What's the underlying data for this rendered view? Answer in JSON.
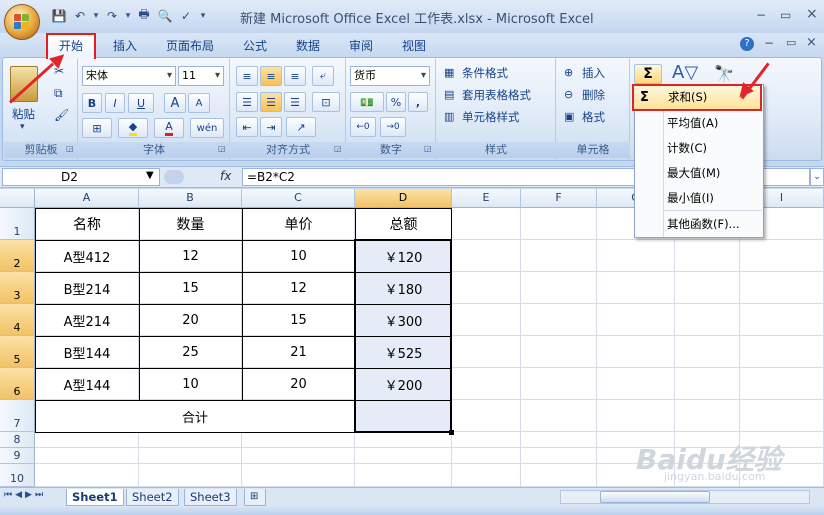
{
  "window": {
    "title": "新建 Microsoft Office Excel 工作表.xlsx - Microsoft Excel",
    "minimize": "−",
    "restore": "▭",
    "close": "×"
  },
  "tabs": [
    "开始",
    "插入",
    "页面布局",
    "公式",
    "数据",
    "审阅",
    "视图"
  ],
  "ribbon": {
    "clipboard": {
      "label": "剪贴板",
      "paste": "粘贴"
    },
    "font": {
      "label": "字体",
      "name": "宋体",
      "size": "11",
      "bold": "B",
      "italic": "I",
      "underline": "U",
      "grow": "A",
      "shrink": "A",
      "color_letter": "A",
      "phonetic": "wén"
    },
    "alignment": {
      "label": "对齐方式"
    },
    "number": {
      "label": "数字",
      "format": "货币",
      "percent": "%",
      "comma": ","
    },
    "styles": {
      "label": "样式",
      "conditional": "条件格式",
      "table": "套用表格格式",
      "cell": "单元格样式"
    },
    "cells": {
      "label": "单元格",
      "insert": "插入",
      "delete": "删除",
      "format": "格式"
    },
    "editing": {
      "sigma": "Σ"
    }
  },
  "formula_bar": {
    "name": "D2",
    "fx": "fx",
    "formula": "=B2*C2"
  },
  "columns": [
    "A",
    "B",
    "C",
    "D",
    "E",
    "F",
    "G",
    "H",
    "I"
  ],
  "rows": [
    "1",
    "2",
    "3",
    "4",
    "5",
    "6",
    "7",
    "8",
    "9",
    "10"
  ],
  "table": {
    "headers": [
      "名称",
      "数量",
      "单价",
      "总额"
    ],
    "rows": [
      [
        "A型412",
        "12",
        "10",
        "￥120"
      ],
      [
        "B型214",
        "15",
        "12",
        "￥180"
      ],
      [
        "A型214",
        "20",
        "15",
        "￥300"
      ],
      [
        "B型144",
        "25",
        "21",
        "￥525"
      ],
      [
        "A型144",
        "10",
        "20",
        "￥200"
      ]
    ],
    "total_label": "合计"
  },
  "sheets": [
    "Sheet1",
    "Sheet2",
    "Sheet3"
  ],
  "autosum_menu": {
    "sigma": "Σ",
    "items": [
      "求和(S)",
      "平均值(A)",
      "计数(C)",
      "最大值(M)",
      "最小值(I)",
      "其他函数(F)..."
    ]
  },
  "watermark": {
    "brand": "Baidu经验",
    "url": "jingyan.baidu.com"
  },
  "colors": {
    "highlight_red": "#e0262b",
    "selection": "#e6ecf7"
  }
}
